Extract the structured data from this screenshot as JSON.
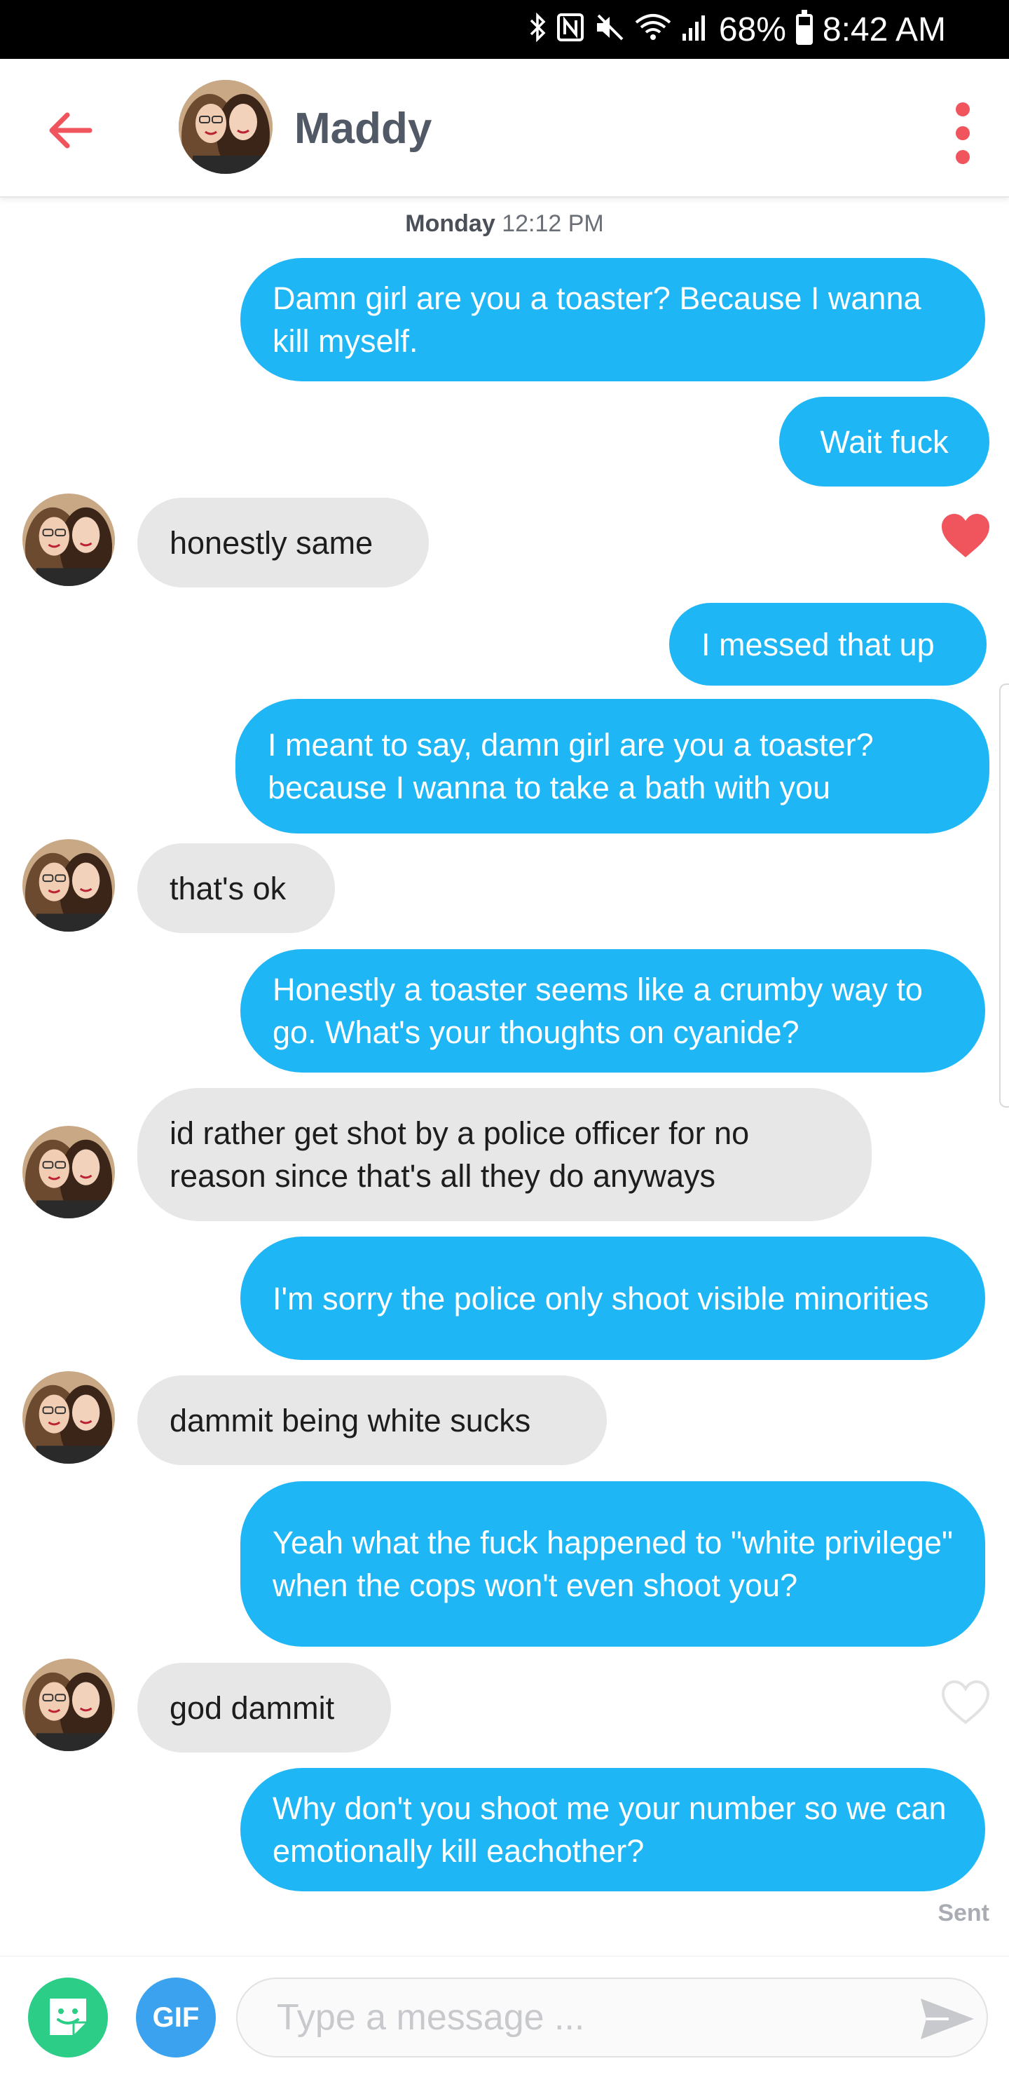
{
  "status_bar": {
    "icons": [
      "bluetooth-icon",
      "nfc-icon",
      "mute-icon",
      "wifi-icon",
      "signal-icon",
      "battery-icon"
    ],
    "battery": "68%",
    "time": "8:42 AM"
  },
  "header": {
    "contact_name": "Maddy"
  },
  "timestamp": {
    "day": "Monday",
    "time": "12:12 PM"
  },
  "messages": [
    {
      "from": "me",
      "text": "Damn girl are you a toaster? Because I wanna kill myself."
    },
    {
      "from": "me",
      "text": "Wait fuck"
    },
    {
      "from": "them",
      "text": "honestly same",
      "liked": true
    },
    {
      "from": "me",
      "text": "I messed that up"
    },
    {
      "from": "me",
      "text": "I meant to say, damn girl are you a toaster? because I wanna to take a bath with you"
    },
    {
      "from": "them",
      "text": "that's ok"
    },
    {
      "from": "me",
      "text": "Honestly a toaster seems like a crumby way to go. What's your thoughts on cyanide?"
    },
    {
      "from": "them",
      "text": "id rather get shot by a police officer for no reason since that's all they do anyways"
    },
    {
      "from": "me",
      "text": "I'm sorry the police only shoot visible minorities"
    },
    {
      "from": "them",
      "text": "dammit being white sucks"
    },
    {
      "from": "me",
      "text": "Yeah what the fuck happened to \"white privilege\" when the cops won't even shoot you?"
    },
    {
      "from": "them",
      "text": "god dammit",
      "liked": false
    },
    {
      "from": "me",
      "text": "Why don't you shoot me your number so we can   emotionally kill eachother?"
    }
  ],
  "sent_label": "Sent",
  "composer": {
    "gif_label": "GIF",
    "placeholder": "Type a message ..."
  },
  "colors": {
    "outgoing_bubble": "#1fb6f5",
    "incoming_bubble": "#e7e7e7",
    "accent": "#f0545c",
    "sticker_button": "#2ccd87",
    "gif_button": "#3aa2ee"
  }
}
